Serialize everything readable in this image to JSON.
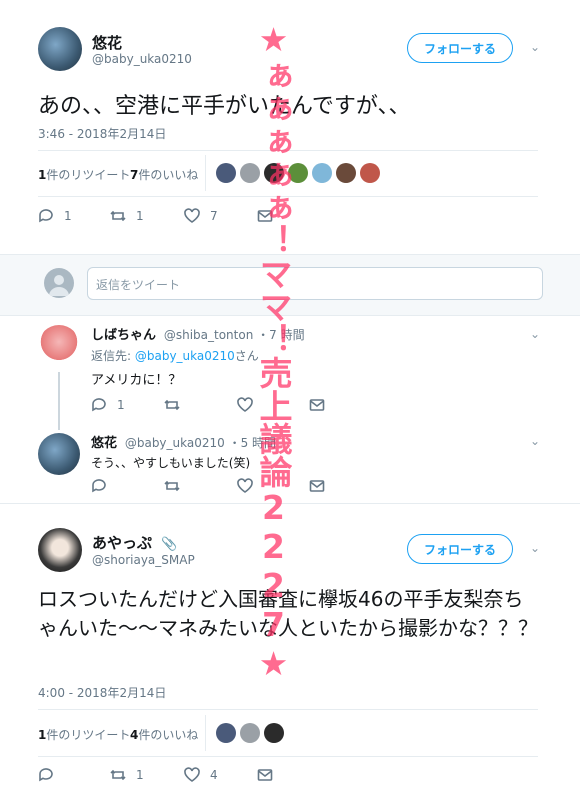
{
  "tweet1": {
    "name": "悠花",
    "handle": "@baby_uka0210",
    "follow_label": "フォローする",
    "text": "あの、、空港に平手がいたんですが、、",
    "timestamp": "3:46 - 2018年2月14日",
    "retweets_num": "1",
    "retweets_label": "件のリツイート",
    "likes_num": "7",
    "likes_label": "件のいいね",
    "reply_count": "1",
    "retweet_count": "1",
    "like_count": "7"
  },
  "reply_box": {
    "placeholder": "返信をツイート"
  },
  "reply1": {
    "name": "しばちゃん",
    "handle": "@shiba_tonton",
    "time": "・7 時間",
    "replying_prefix": "返信先: ",
    "replying_to": "@baby_uka0210",
    "replying_suffix": "さん",
    "text": "アメリカに！？",
    "reply_count": "1"
  },
  "reply2": {
    "name": "悠花",
    "handle": "@baby_uka0210",
    "time": "・5 時間",
    "text": "そう、、やすしもいました(笑)"
  },
  "tweet2": {
    "name": "あやっぷ",
    "handle": "@shoriaya_SMAP",
    "follow_label": "フォローする",
    "text": "ロスついたんだけど入国審査に欅坂46の平手友梨奈ちゃんいた〜〜マネみたいな人といたから撮影かな？？？",
    "timestamp": "4:00 - 2018年2月14日",
    "retweets_num": "1",
    "retweets_label": "件のリツイート",
    "likes_num": "4",
    "likes_label": "件のいいね",
    "retweet_count": "1",
    "like_count": "4"
  },
  "watermark": "★ぁぁぁぁぁ！ママ！売上議論2227★",
  "colors": {
    "accent": "#1da1f2",
    "watermark": "#ff3366"
  }
}
